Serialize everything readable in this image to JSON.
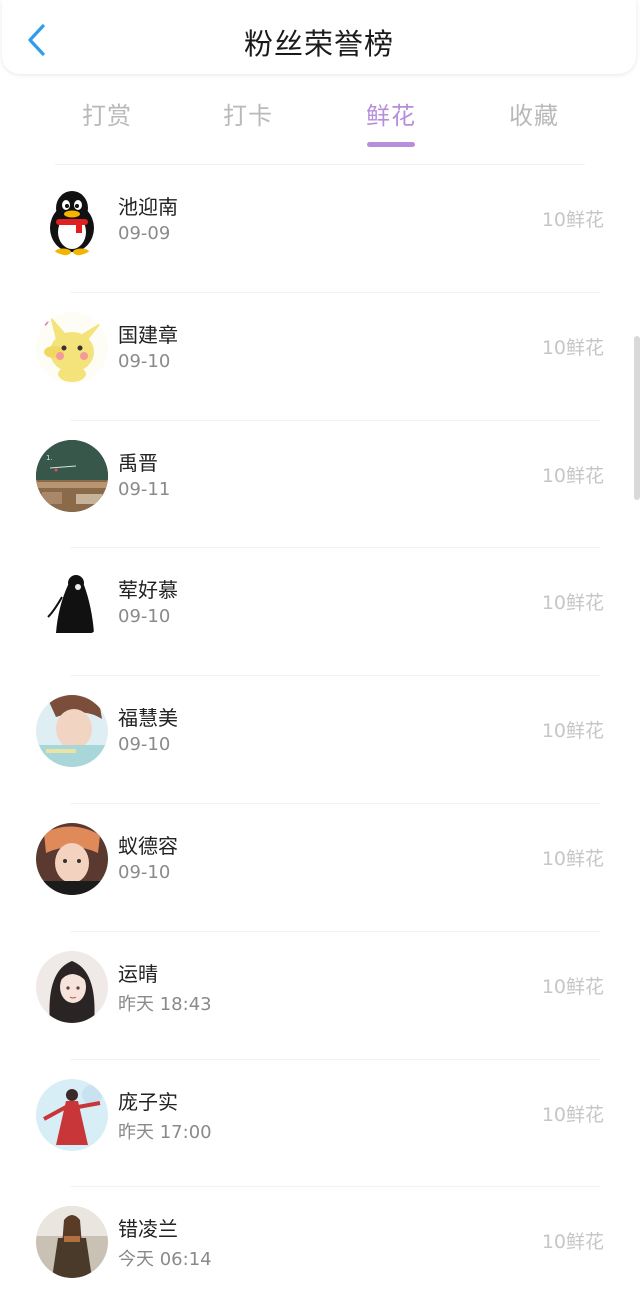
{
  "header": {
    "title": "粉丝荣誉榜"
  },
  "tabs": [
    {
      "label": "打赏",
      "active": false
    },
    {
      "label": "打卡",
      "active": false
    },
    {
      "label": "鲜花",
      "active": true
    },
    {
      "label": "收藏",
      "active": false
    }
  ],
  "colors": {
    "accent": "#b58fda",
    "back_arrow": "#2d9cf0",
    "inactive_tab": "#b9b9b9"
  },
  "fans": [
    {
      "name": "池迎南",
      "date": "09-09",
      "count": "10鲜花",
      "avatar": "penguin-avatar"
    },
    {
      "name": "国建章",
      "date": "09-10",
      "count": "10鲜花",
      "avatar": "pikachu-avatar"
    },
    {
      "name": "禹晋",
      "date": "09-11",
      "count": "10鲜花",
      "avatar": "classroom-avatar"
    },
    {
      "name": "荤好慕",
      "date": "09-10",
      "count": "10鲜花",
      "avatar": "ink-figure-avatar"
    },
    {
      "name": "福慧美",
      "date": "09-10",
      "count": "10鲜花",
      "avatar": "portrait-avatar"
    },
    {
      "name": "蚁德容",
      "date": "09-10",
      "count": "10鲜花",
      "avatar": "selfie-avatar"
    },
    {
      "name": "运晴",
      "date": "昨天 18:43",
      "count": "10鲜花",
      "avatar": "anime-girl-avatar"
    },
    {
      "name": "庞子实",
      "date": "昨天 17:00",
      "count": "10鲜花",
      "avatar": "red-dancer-avatar"
    },
    {
      "name": "错凌兰",
      "date": "今天 06:14",
      "count": "10鲜花",
      "avatar": "winter-girl-avatar"
    }
  ]
}
